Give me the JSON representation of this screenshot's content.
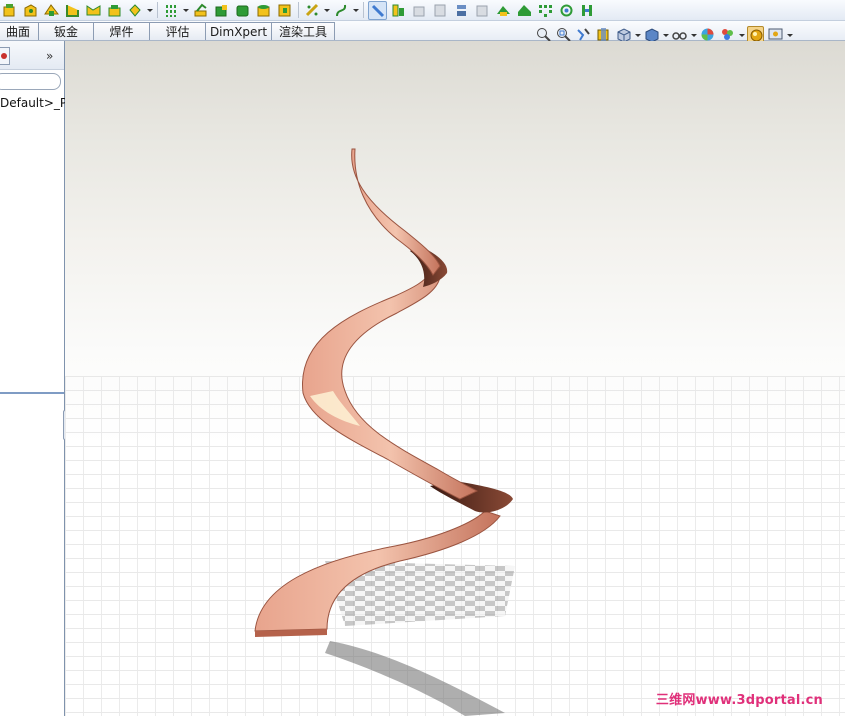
{
  "toolbar": {
    "icons": [
      "part-icon",
      "save-icon",
      "extrude-icon",
      "revolve-icon",
      "sweep-icon",
      "loft-icon",
      "pattern-icon",
      "mirror-icon",
      "fillet-icon",
      "chamfer-icon",
      "shell-icon",
      "rib-icon",
      "draft-icon",
      "reference-geometry-icon",
      "curves-icon",
      "display-icon",
      "move-face-icon",
      "split-icon",
      "intersect-icon",
      "combine-icon",
      "wrap-icon",
      "dome-icon",
      "freeform-icon",
      "deform-icon",
      "flex-icon",
      "indent-icon"
    ]
  },
  "tabs": [
    {
      "label": "曲面"
    },
    {
      "label": "钣金"
    },
    {
      "label": "焊件"
    },
    {
      "label": "评估"
    },
    {
      "label": "DimXpert"
    },
    {
      "label": "渲染工具"
    }
  ],
  "sidebar": {
    "expand_label": "»",
    "config_text": "Default>_P"
  },
  "view_toolbar": {
    "icons": [
      "zoom-to-fit-icon",
      "zoom-area-icon",
      "previous-view-icon",
      "section-view-icon",
      "view-orientation-icon",
      "display-style-icon",
      "hide-show-icon",
      "edit-appearance-icon",
      "scene-icon",
      "realview-icon",
      "view-settings-icon"
    ]
  },
  "model": {
    "color": "#d9876d",
    "shadow_color": "#6b6b6b"
  },
  "watermark": {
    "text": "三维网www.3dportal.cn"
  }
}
